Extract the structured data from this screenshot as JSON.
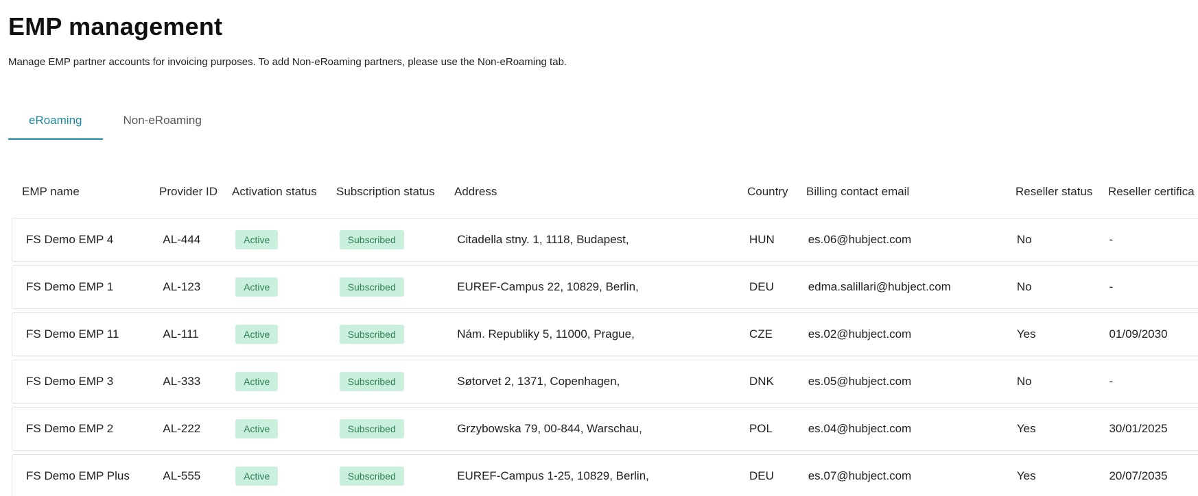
{
  "page": {
    "title": "EMP management",
    "subtitle": "Manage EMP partner accounts for invoicing purposes. To add Non-eRoaming partners, please use the Non-eRoaming tab."
  },
  "tabs": [
    {
      "label": "eRoaming",
      "active": true
    },
    {
      "label": "Non-eRoaming",
      "active": false
    }
  ],
  "table": {
    "headers": {
      "name": "EMP name",
      "provider_id": "Provider ID",
      "activation": "Activation status",
      "subscription": "Subscription status",
      "address": "Address",
      "country": "Country",
      "email": "Billing contact email",
      "reseller": "Reseller status",
      "certificate": "Reseller certifica"
    },
    "rows": [
      {
        "name": "FS Demo EMP 4",
        "provider_id": "AL-444",
        "activation": "Active",
        "subscription": "Subscribed",
        "address": "Citadella stny. 1, 1118, Budapest,",
        "country": "HUN",
        "email": "es.06@hubject.com",
        "reseller": "No",
        "certificate": "-"
      },
      {
        "name": "FS Demo EMP 1",
        "provider_id": "AL-123",
        "activation": "Active",
        "subscription": "Subscribed",
        "address": "EUREF-Campus 22, 10829, Berlin,",
        "country": "DEU",
        "email": "edma.salillari@hubject.com",
        "reseller": "No",
        "certificate": "-"
      },
      {
        "name": "FS Demo EMP 11",
        "provider_id": "AL-111",
        "activation": "Active",
        "subscription": "Subscribed",
        "address": "Nám. Republiky 5, 11000, Prague,",
        "country": "CZE",
        "email": "es.02@hubject.com",
        "reseller": "Yes",
        "certificate": "01/09/2030"
      },
      {
        "name": "FS Demo EMP 3",
        "provider_id": "AL-333",
        "activation": "Active",
        "subscription": "Subscribed",
        "address": "Søtorvet 2, 1371, Copenhagen,",
        "country": "DNK",
        "email": "es.05@hubject.com",
        "reseller": "No",
        "certificate": "-"
      },
      {
        "name": "FS Demo EMP 2",
        "provider_id": "AL-222",
        "activation": "Active",
        "subscription": "Subscribed",
        "address": "Grzybowska 79, 00-844, Warschau,",
        "country": "POL",
        "email": "es.04@hubject.com",
        "reseller": "Yes",
        "certificate": "30/01/2025"
      },
      {
        "name": "FS Demo EMP Plus",
        "provider_id": "AL-555",
        "activation": "Active",
        "subscription": "Subscribed",
        "address": "EUREF-Campus 1-25, 10829, Berlin,",
        "country": "DEU",
        "email": "es.07@hubject.com",
        "reseller": "Yes",
        "certificate": "20/07/2035"
      }
    ]
  },
  "colors": {
    "accent": "#1a8a9c",
    "badge_bg": "#c8f0dc",
    "badge_text": "#2e7d54"
  }
}
